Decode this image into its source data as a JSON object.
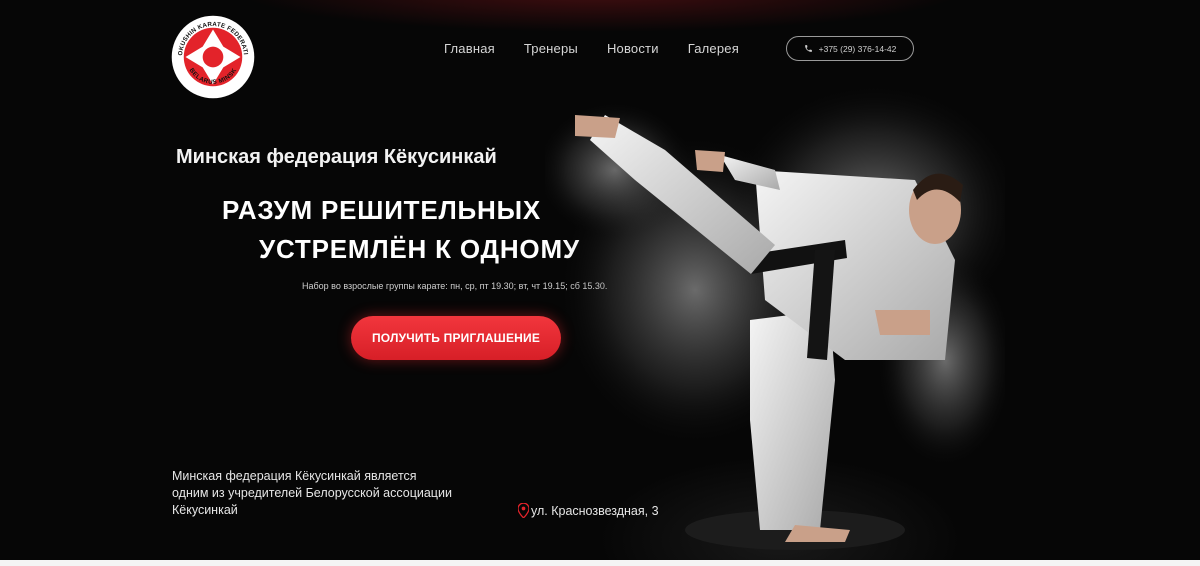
{
  "logo": {
    "ring_text_top": "KYOKUSHIN KARATE FEDERATION",
    "ring_text_bottom": "BELARUS MINSK",
    "brand_color": "#e3232a"
  },
  "nav": {
    "items": [
      {
        "label": "Главная"
      },
      {
        "label": "Тренеры"
      },
      {
        "label": "Новости"
      },
      {
        "label": "Галерея"
      }
    ]
  },
  "phone": {
    "icon": "phone-icon",
    "number": "+375 (29) 376-14-42"
  },
  "hero": {
    "subtitle": "Минская федерация Кёкусинкай",
    "headline_line1": "РАЗУМ РЕШИТЕЛЬНЫХ",
    "headline_line2": "УСТРЕМЛЁН К ОДНОМУ",
    "schedule": "Набор во взрослые группы карате: пн, ср, пт 19.30; вт, чт 19.15; сб 15.30.",
    "cta_label": "ПОЛУЧИТЬ ПРИГЛАШЕНИЕ",
    "cta_color": "#e32a31"
  },
  "footer": {
    "about": "Минская федерация Кёкусинкай является одним из учредителей Белорусской ассоциации Кёкусинкай",
    "address_icon": "map-pin-icon",
    "address": "ул. Краснозвездная, 3"
  },
  "colors": {
    "background": "#060606",
    "accent": "#e3232a",
    "nav_text": "#d6d6d6"
  }
}
